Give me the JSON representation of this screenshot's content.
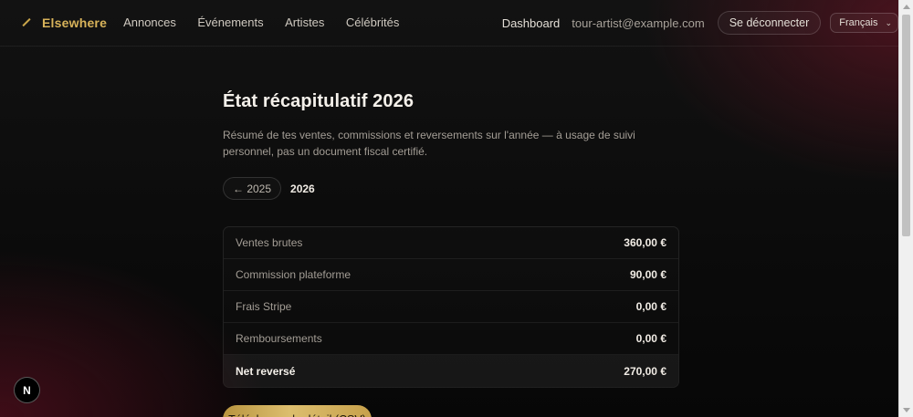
{
  "header": {
    "brand": "Elsewhere",
    "nav": [
      "Annonces",
      "Événements",
      "Artistes",
      "Célébrités"
    ],
    "dashboard": "Dashboard",
    "email": "tour-artist@example.com",
    "logout": "Se déconnecter",
    "language": "Français"
  },
  "main": {
    "title": "État récapitulatif 2026",
    "subtitle": "Résumé de tes ventes, commissions et reversements sur l'année — à usage de suivi personnel, pas un document fiscal certifié.",
    "prev_year": "← 2025",
    "current_year": "2026",
    "rows": [
      {
        "label": "Ventes brutes",
        "value": "360,00 €"
      },
      {
        "label": "Commission plateforme",
        "value": "90,00 €"
      },
      {
        "label": "Frais Stripe",
        "value": "0,00 €"
      },
      {
        "label": "Remboursements",
        "value": "0,00 €"
      }
    ],
    "total": {
      "label": "Net reversé",
      "value": "270,00 €"
    },
    "csv_button": "Télécharger le détail (CSV)"
  },
  "badge": "N"
}
